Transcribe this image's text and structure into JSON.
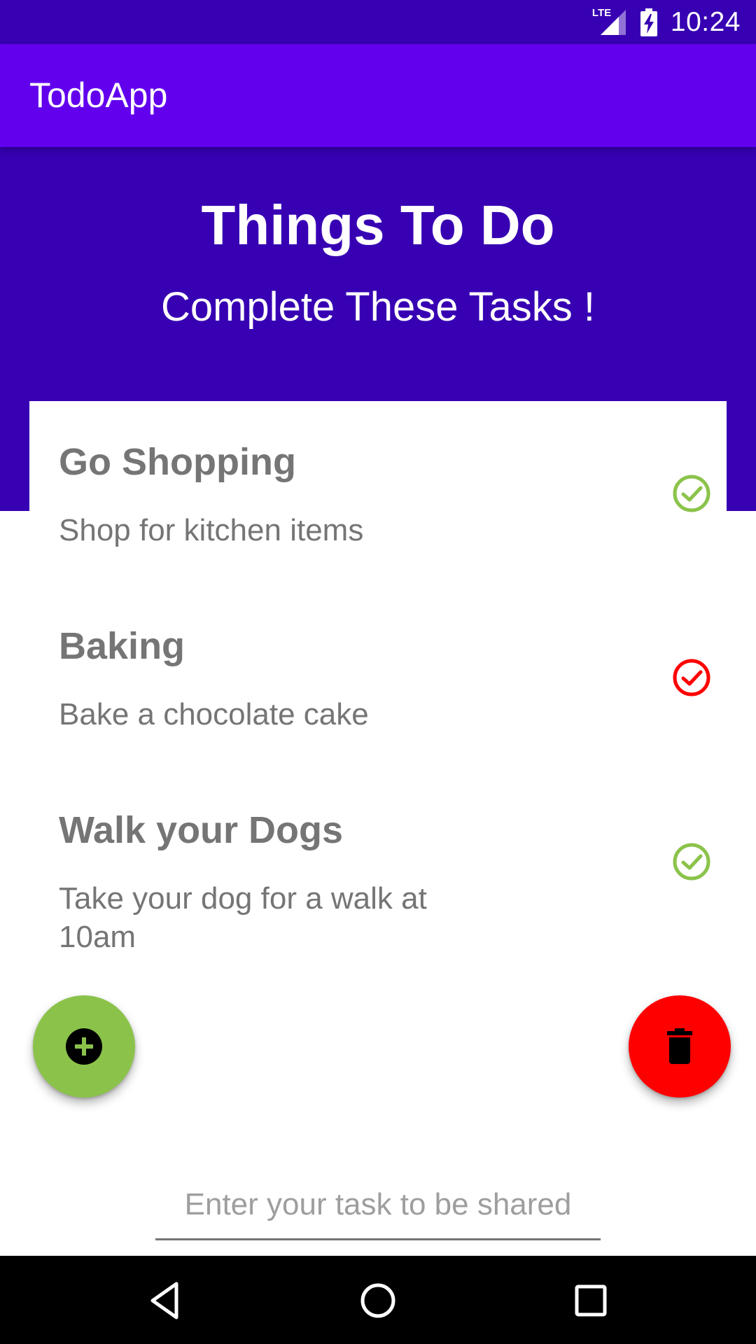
{
  "status_bar": {
    "network_label": "LTE",
    "time": "10:24"
  },
  "app_bar": {
    "title": "TodoApp"
  },
  "header": {
    "title": "Things To Do",
    "subtitle": "Complete These Tasks !"
  },
  "tasks": [
    {
      "title": "Go Shopping",
      "description": "Shop for kitchen items",
      "check_color": "#8bc34a"
    },
    {
      "title": "Baking",
      "description": "Bake a chocolate cake",
      "check_color": "#ff0000"
    },
    {
      "title": "Walk your Dogs",
      "description": "Take your dog for a walk at 10am",
      "check_color": "#8bc34a"
    }
  ],
  "fabs": {
    "add_icon": "plus-circle-icon",
    "delete_icon": "trash-icon"
  },
  "input": {
    "placeholder": "Enter your task to be shared",
    "value": ""
  },
  "nav_bar": {
    "back_icon": "back-icon",
    "home_icon": "home-icon",
    "recents_icon": "recents-icon"
  },
  "colors": {
    "primary": "#6200ee",
    "primary_dark": "#3700b3",
    "add_fab": "#8bc34a",
    "delete_fab": "#ff0000"
  }
}
